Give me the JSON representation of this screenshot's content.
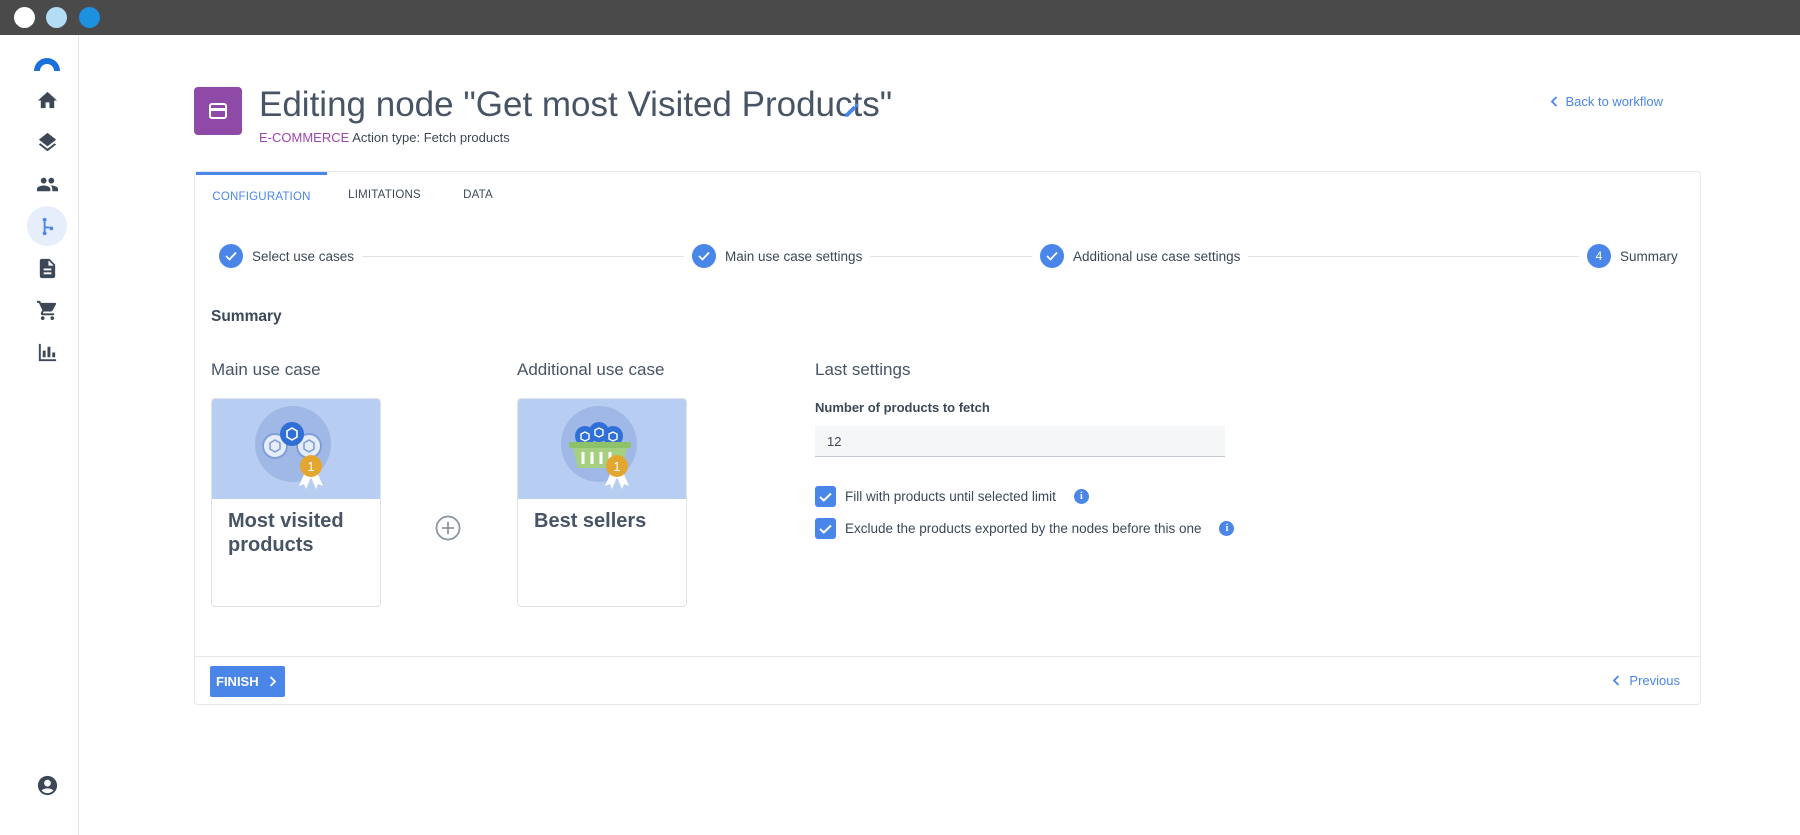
{
  "titlebar": {
    "dot_colors": [
      "#ffffff",
      "#b3dcf5",
      "#1e90e0"
    ]
  },
  "sidebar": {
    "items": [
      {
        "name": "home-icon",
        "active": false
      },
      {
        "name": "layers-icon",
        "active": false
      },
      {
        "name": "people-icon",
        "active": false
      },
      {
        "name": "workflow-icon",
        "active": true
      },
      {
        "name": "document-icon",
        "active": false
      },
      {
        "name": "cart-icon",
        "active": false
      },
      {
        "name": "chart-icon",
        "active": false
      }
    ],
    "account_icon": "account-icon"
  },
  "header": {
    "title": "Editing node \"Get most Visited Products\"",
    "category": "E-COMMERCE",
    "action_type": "Action type: Fetch products",
    "back_label": "Back to workflow"
  },
  "tabs": [
    {
      "label": "CONFIGURATION",
      "active": true
    },
    {
      "label": "LIMITATIONS",
      "active": false
    },
    {
      "label": "DATA",
      "active": false
    }
  ],
  "stepper": {
    "steps": [
      {
        "label": "Select use cases",
        "state": "done"
      },
      {
        "label": "Main use case settings",
        "state": "done"
      },
      {
        "label": "Additional use case settings",
        "state": "done"
      },
      {
        "label": "Summary",
        "state": "current",
        "number": "4"
      }
    ]
  },
  "summary": {
    "section_title": "Summary",
    "main_title": "Main use case",
    "main_card": "Most visited products",
    "additional_title": "Additional use case",
    "additional_card": "Best sellers",
    "badge_number": "1",
    "last_settings_title": "Last settings",
    "products_label": "Number of products to fetch",
    "products_value": "12",
    "fill_label": "Fill with products until selected limit",
    "fill_checked": true,
    "exclude_label": "Exclude the products exported by the nodes before this one",
    "exclude_checked": true
  },
  "footer": {
    "finish_label": "FINISH",
    "previous_label": "Previous"
  },
  "colors": {
    "accent": "#4a86e8",
    "node": "#8f4aa8",
    "category": "#9c45b0"
  }
}
